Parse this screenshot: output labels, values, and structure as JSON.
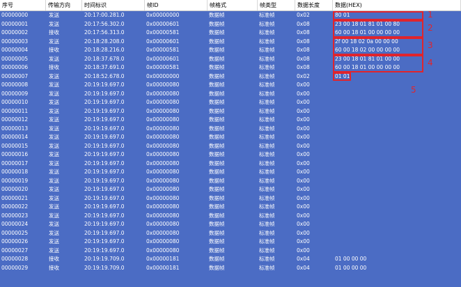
{
  "columns": [
    "序号",
    "传输方向",
    "时间标识",
    "帧ID",
    "帧格式",
    "帧类型",
    "数据长度",
    "数据(HEX)"
  ],
  "rows": [
    [
      "00000000",
      "发送",
      "20:17:00.281.0",
      "0x00000000",
      "数据帧",
      "标准帧",
      "0x02",
      "80 01"
    ],
    [
      "00000001",
      "发送",
      "20:17:56.302.0",
      "0x00000601",
      "数据帧",
      "标准帧",
      "0x08",
      "23 00 18 01 81 01 00 80"
    ],
    [
      "00000002",
      "接收",
      "20:17:56.313.0",
      "0x00000581",
      "数据帧",
      "标准帧",
      "0x08",
      "60 00 18 01 00 00 00 00"
    ],
    [
      "00000003",
      "发送",
      "20:18:28.208.0",
      "0x00000601",
      "数据帧",
      "标准帧",
      "0x08",
      "2f 00 18 02 0a 00 00 00"
    ],
    [
      "00000004",
      "接收",
      "20:18:28.216.0",
      "0x00000581",
      "数据帧",
      "标准帧",
      "0x08",
      "60 00 18 02 00 00 00 00"
    ],
    [
      "00000005",
      "发送",
      "20:18:37.678.0",
      "0x00000601",
      "数据帧",
      "标准帧",
      "0x08",
      "23 00 18 01 81 01 00 00"
    ],
    [
      "00000006",
      "接收",
      "20:18:37.691.0",
      "0x00000581",
      "数据帧",
      "标准帧",
      "0x08",
      "60 00 18 01 00 00 00 00"
    ],
    [
      "00000007",
      "发送",
      "20:18:52.678.0",
      "0x00000000",
      "数据帧",
      "标准帧",
      "0x02",
      "01 01"
    ],
    [
      "00000008",
      "发送",
      "20:19:19.697.0",
      "0x00000080",
      "数据帧",
      "标准帧",
      "0x00",
      ""
    ],
    [
      "00000009",
      "发送",
      "20:19:19.697.0",
      "0x00000080",
      "数据帧",
      "标准帧",
      "0x00",
      ""
    ],
    [
      "00000010",
      "发送",
      "20:19:19.697.0",
      "0x00000080",
      "数据帧",
      "标准帧",
      "0x00",
      ""
    ],
    [
      "00000011",
      "发送",
      "20:19:19.697.0",
      "0x00000080",
      "数据帧",
      "标准帧",
      "0x00",
      ""
    ],
    [
      "00000012",
      "发送",
      "20:19:19.697.0",
      "0x00000080",
      "数据帧",
      "标准帧",
      "0x00",
      ""
    ],
    [
      "00000013",
      "发送",
      "20:19:19.697.0",
      "0x00000080",
      "数据帧",
      "标准帧",
      "0x00",
      ""
    ],
    [
      "00000014",
      "发送",
      "20:19:19.697.0",
      "0x00000080",
      "数据帧",
      "标准帧",
      "0x00",
      ""
    ],
    [
      "00000015",
      "发送",
      "20:19:19.697.0",
      "0x00000080",
      "数据帧",
      "标准帧",
      "0x00",
      ""
    ],
    [
      "00000016",
      "发送",
      "20:19:19.697.0",
      "0x00000080",
      "数据帧",
      "标准帧",
      "0x00",
      ""
    ],
    [
      "00000017",
      "发送",
      "20:19:19.697.0",
      "0x00000080",
      "数据帧",
      "标准帧",
      "0x00",
      ""
    ],
    [
      "00000018",
      "发送",
      "20:19:19.697.0",
      "0x00000080",
      "数据帧",
      "标准帧",
      "0x00",
      ""
    ],
    [
      "00000019",
      "发送",
      "20:19:19.697.0",
      "0x00000080",
      "数据帧",
      "标准帧",
      "0x00",
      ""
    ],
    [
      "00000020",
      "发送",
      "20:19:19.697.0",
      "0x00000080",
      "数据帧",
      "标准帧",
      "0x00",
      ""
    ],
    [
      "00000021",
      "发送",
      "20:19:19.697.0",
      "0x00000080",
      "数据帧",
      "标准帧",
      "0x00",
      ""
    ],
    [
      "00000022",
      "发送",
      "20:19:19.697.0",
      "0x00000080",
      "数据帧",
      "标准帧",
      "0x00",
      ""
    ],
    [
      "00000023",
      "发送",
      "20:19:19.697.0",
      "0x00000080",
      "数据帧",
      "标准帧",
      "0x00",
      ""
    ],
    [
      "00000024",
      "发送",
      "20:19:19.697.0",
      "0x00000080",
      "数据帧",
      "标准帧",
      "0x00",
      ""
    ],
    [
      "00000025",
      "发送",
      "20:19:19.697.0",
      "0x00000080",
      "数据帧",
      "标准帧",
      "0x00",
      ""
    ],
    [
      "00000026",
      "发送",
      "20:19:19.697.0",
      "0x00000080",
      "数据帧",
      "标准帧",
      "0x00",
      ""
    ],
    [
      "00000027",
      "发送",
      "20:19:19.697.0",
      "0x00000080",
      "数据帧",
      "标准帧",
      "0x00",
      ""
    ],
    [
      "00000028",
      "接收",
      "20:19:19.709.0",
      "0x00000181",
      "数据帧",
      "标准帧",
      "0x04",
      "01 00 00 00"
    ],
    [
      "00000029",
      "接收",
      "20:19:19.709.0",
      "0x00000181",
      "数据帧",
      "标准帧",
      "0x04",
      "01 00 00 00"
    ]
  ],
  "annotations": [
    {
      "label": "1",
      "first_row": 0,
      "last_row": 0
    },
    {
      "label": "2",
      "first_row": 1,
      "last_row": 2
    },
    {
      "label": "3",
      "first_row": 3,
      "last_row": 4
    },
    {
      "label": "4",
      "first_row": 5,
      "last_row": 6
    },
    {
      "label": "5",
      "first_row": 7,
      "last_row": 7
    }
  ],
  "colors": {
    "background": "#4b6cc4",
    "header_bg": "#ffffff",
    "text": "#ffffff",
    "annotation": "#e0242c"
  }
}
